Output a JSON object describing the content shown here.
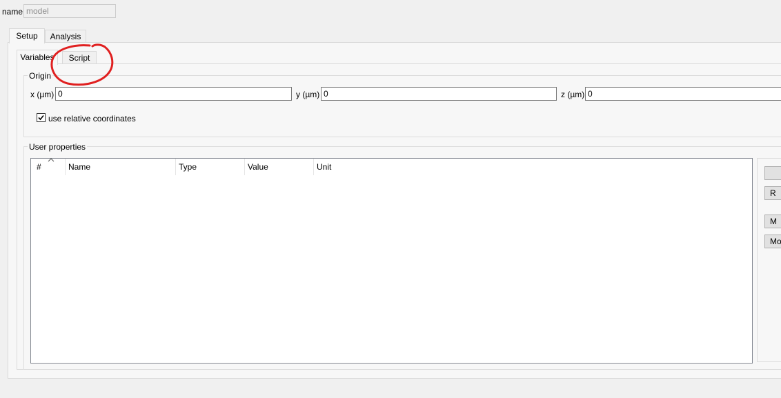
{
  "name_field": {
    "label": "name",
    "value": "model"
  },
  "main_tabs": [
    {
      "label": "Setup",
      "active": true
    },
    {
      "label": "Analysis",
      "active": false
    }
  ],
  "sub_tabs": [
    {
      "label": "Variables",
      "active": true
    },
    {
      "label": "Script",
      "active": false
    }
  ],
  "origin": {
    "title": "Origin",
    "x_label": "x (µm)",
    "x_value": "0",
    "y_label": "y (µm)",
    "y_value": "0",
    "z_label": "z (µm)",
    "z_value": "0",
    "relative_label": "use relative coordinates",
    "relative_checked": true
  },
  "user_properties": {
    "title": "User properties",
    "columns": [
      "#",
      "Name",
      "Type",
      "Value",
      "Unit"
    ],
    "rows": [],
    "buttons": [
      "",
      "R",
      "M",
      "Mov"
    ]
  },
  "annotation": {
    "color": "#e02020"
  }
}
